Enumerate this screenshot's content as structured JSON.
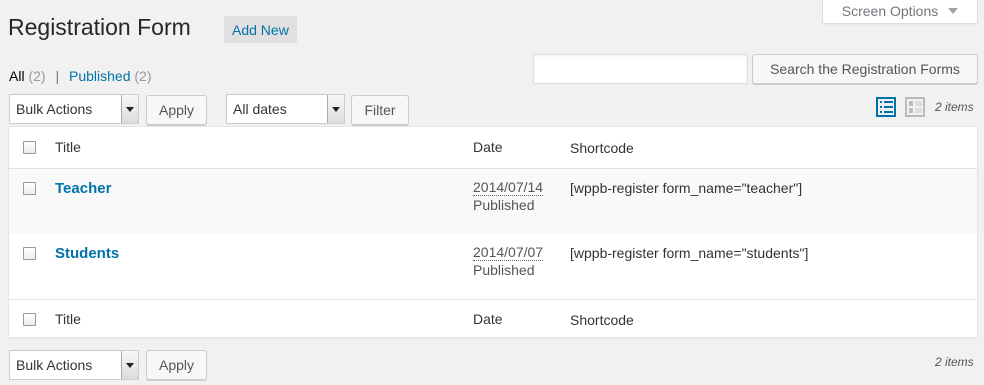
{
  "screen_options": {
    "label": "Screen Options"
  },
  "heading": {
    "title": "Registration Form",
    "add_new": "Add New"
  },
  "views": {
    "all_label": "All",
    "all_count": "(2)",
    "separator": "|",
    "published_label": "Published",
    "published_count": "(2)"
  },
  "search": {
    "value": "",
    "button": "Search the Registration Forms"
  },
  "top_nav": {
    "bulk_actions": "Bulk Actions",
    "apply": "Apply",
    "dates": "All dates",
    "filter": "Filter",
    "items_count": "2 items"
  },
  "table": {
    "columns": {
      "title": "Title",
      "date": "Date",
      "shortcode": "Shortcode"
    },
    "rows": [
      {
        "title": "Teacher",
        "date": "2014/07/14",
        "status": "Published",
        "shortcode": "[wppb-register form_name=\"teacher\"]"
      },
      {
        "title": "Students",
        "date": "2014/07/07",
        "status": "Published",
        "shortcode": "[wppb-register form_name=\"students\"]"
      }
    ]
  },
  "bottom_nav": {
    "bulk_actions": "Bulk Actions",
    "apply": "Apply",
    "items_count": "2 items"
  },
  "colors": {
    "link": "#0073aa",
    "background": "#f1f1f1",
    "heading": "#23282d"
  }
}
